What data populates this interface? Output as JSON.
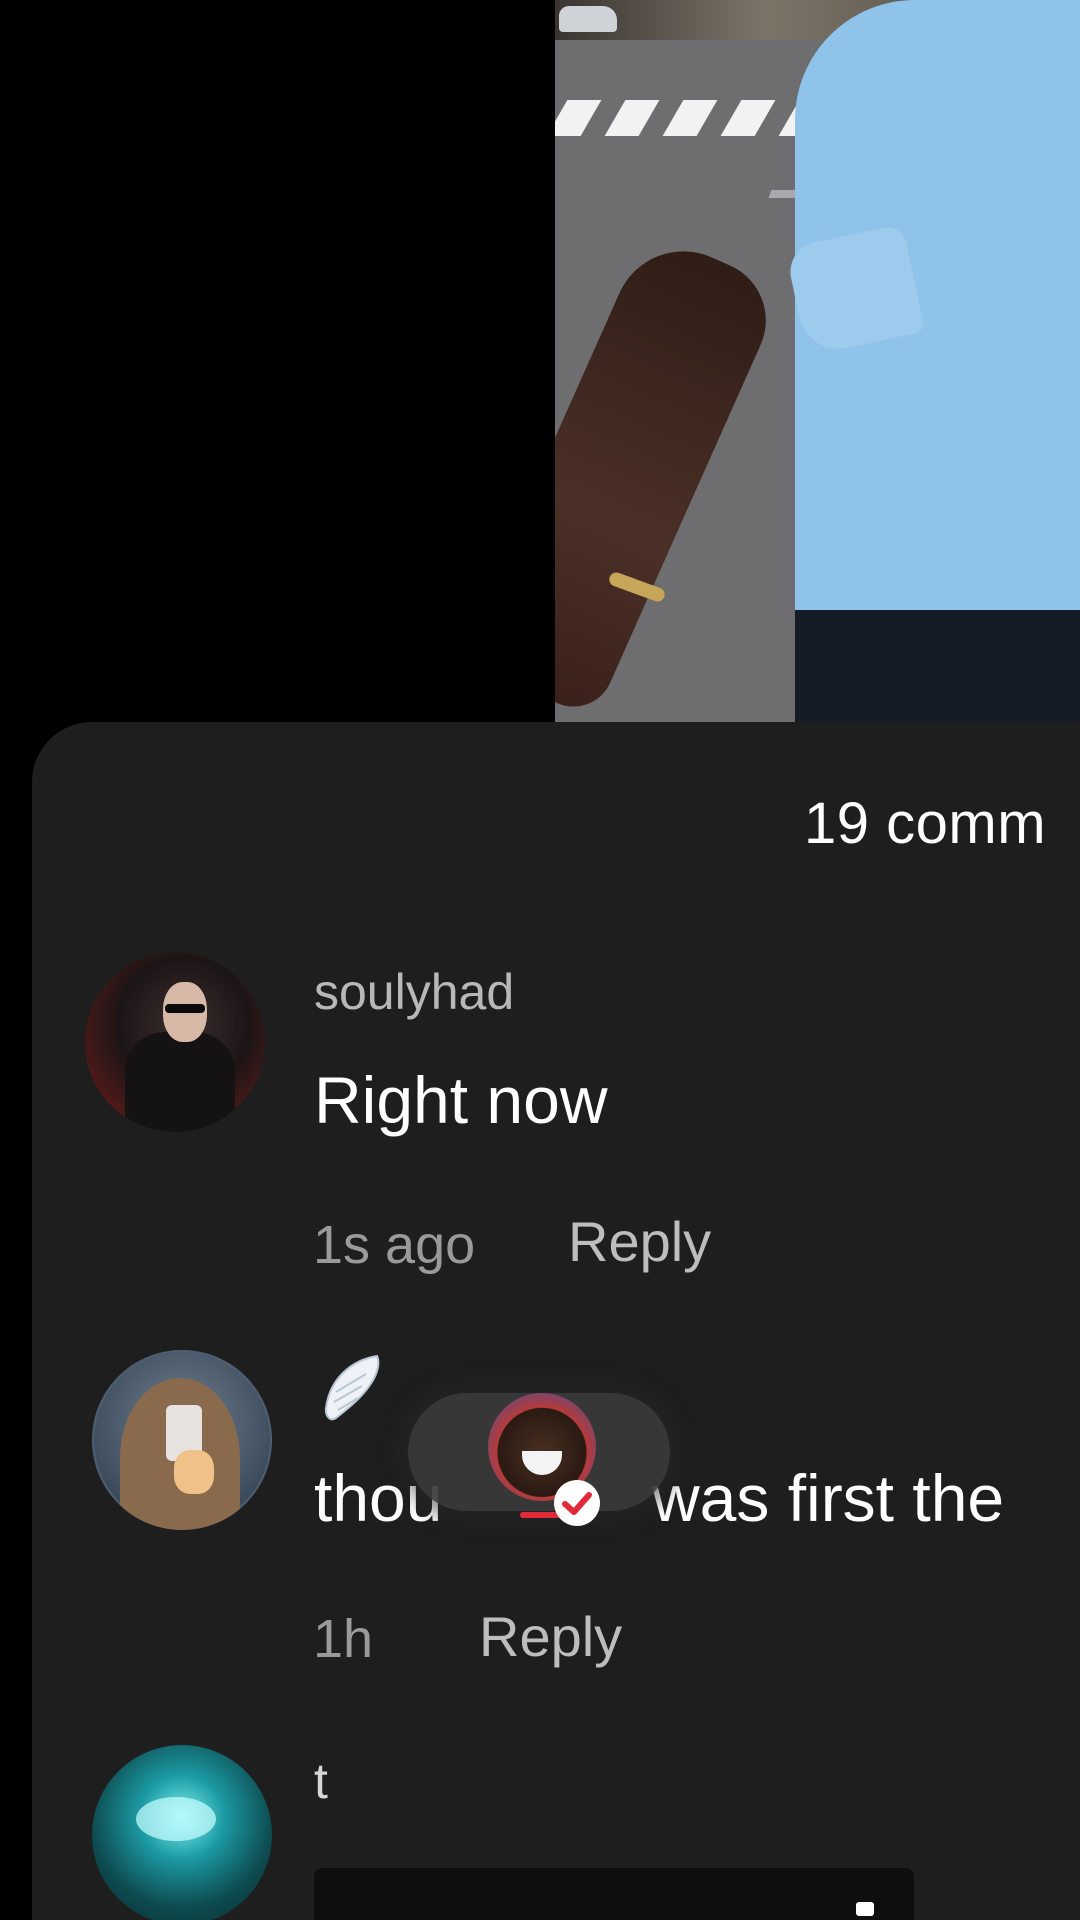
{
  "comments_panel": {
    "count_label": "19 comm"
  },
  "comments": [
    {
      "username": "soulyhad",
      "text": "Right now",
      "time": "1s ago",
      "reply_label": "Reply"
    },
    {
      "username_icon": "angel-wing-icon",
      "text_left": "thou",
      "text_right": "was first the",
      "time": "1h",
      "reply_label": "Reply"
    },
    {
      "username": "t"
    }
  ],
  "overlay": {
    "badge_icon": "verified-check-icon",
    "accent_color": "#e02a3a"
  },
  "colors": {
    "sheet_bg": "#1e1e1e",
    "primary_text": "#ffffff",
    "secondary_text": "#9a9a9a"
  }
}
